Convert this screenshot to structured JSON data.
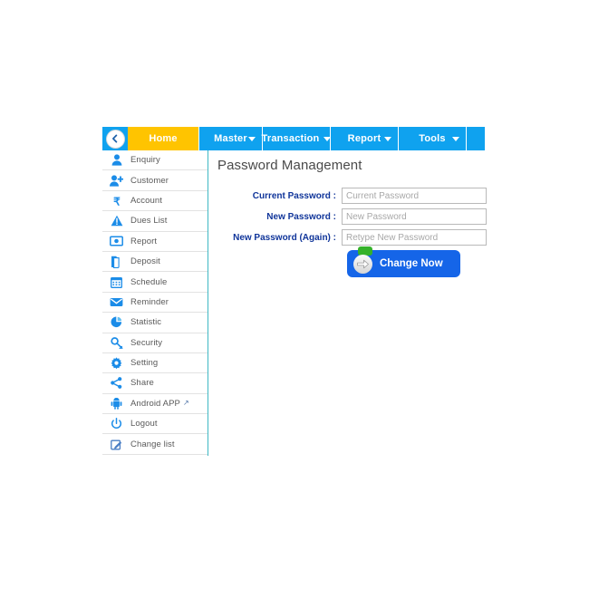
{
  "navbar": {
    "back_icon": "chevron-left-icon",
    "tabs": [
      {
        "label": "Home",
        "active": true,
        "has_caret": false
      },
      {
        "label": "Master",
        "active": false,
        "has_caret": true
      },
      {
        "label": "Transaction",
        "active": false,
        "has_caret": true
      },
      {
        "label": "Report",
        "active": false,
        "has_caret": true
      },
      {
        "label": "Tools",
        "active": false,
        "has_caret": true
      }
    ],
    "active_color": "#ffc400",
    "bar_color": "#0fa2ef"
  },
  "sidebar": {
    "items": [
      {
        "label": "Enquiry",
        "icon": "user-icon",
        "external": false
      },
      {
        "label": "Customer",
        "icon": "user-add-icon",
        "external": false
      },
      {
        "label": "Account",
        "icon": "rupee-icon",
        "external": false
      },
      {
        "label": "Dues List",
        "icon": "warning-icon",
        "external": false
      },
      {
        "label": "Report",
        "icon": "banknote-icon",
        "external": false
      },
      {
        "label": "Deposit",
        "icon": "document-icon",
        "external": false
      },
      {
        "label": "Schedule",
        "icon": "calendar-icon",
        "external": false
      },
      {
        "label": "Reminder",
        "icon": "envelope-icon",
        "external": false
      },
      {
        "label": "Statistic",
        "icon": "pie-chart-icon",
        "external": false
      },
      {
        "label": "Security",
        "icon": "key-icon",
        "external": false
      },
      {
        "label": "Setting",
        "icon": "gear-icon",
        "external": false
      },
      {
        "label": "Share",
        "icon": "share-icon",
        "external": false
      },
      {
        "label": "Android APP",
        "icon": "android-icon",
        "external": true
      },
      {
        "label": "Logout",
        "icon": "power-icon",
        "external": false
      },
      {
        "label": "Change list",
        "icon": "edit-square-icon",
        "external": false
      }
    ],
    "external_glyph": "↗",
    "icon_color": "#1b8ce8"
  },
  "main": {
    "title": "Password Management",
    "fields": [
      {
        "label": "Current Password :",
        "value": "",
        "placeholder": "Current Password"
      },
      {
        "label": "New Password :",
        "value": "",
        "placeholder": "New Password"
      },
      {
        "label": "New Password (Again) :",
        "value": "",
        "placeholder": "Retype New Password"
      }
    ],
    "submit": {
      "label": "Change Now",
      "icon": "arrow-right-icon",
      "color": "#1565e8"
    },
    "label_color": "#10359a"
  }
}
